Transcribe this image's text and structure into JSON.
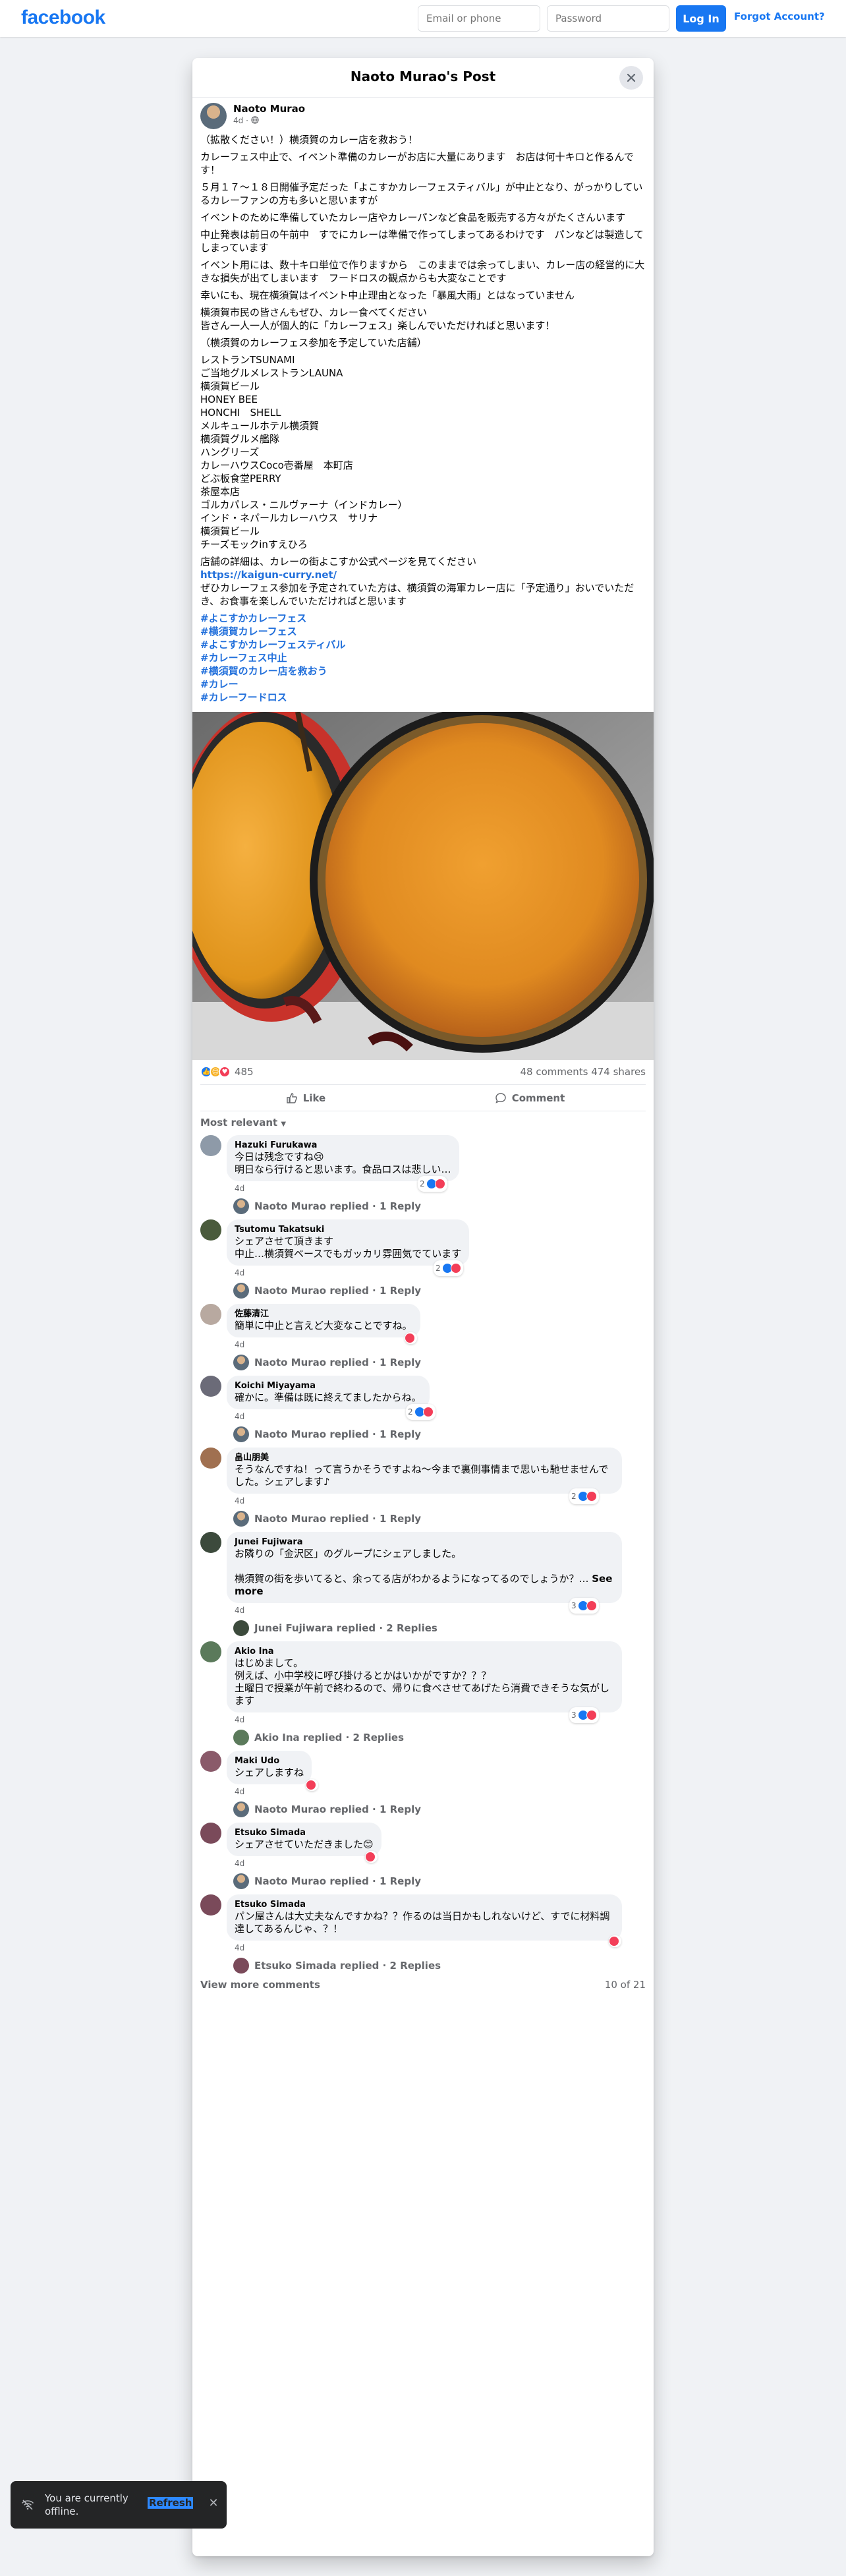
{
  "header": {
    "logo": "facebook",
    "email_placeholder": "Email or phone",
    "password_placeholder": "Password",
    "login_label": "Log In",
    "forgot_label": "Forgot Account?"
  },
  "dialog": {
    "title": "Naoto Murao's Post",
    "close_icon": "close-icon"
  },
  "post": {
    "author": "Naoto Murao",
    "time": "4d",
    "privacy_icon": "globe-icon",
    "paragraphs": [
      "（拡散ください！）横須賀のカレー店を救おう！",
      "カレーフェス中止で、イベント準備のカレーがお店に大量にあります　お店は何十キロと作るんです！",
      "５月１７〜１８日開催予定だった「よこすかカレーフェスティバル」が中止となり、がっかりしているカレーファンの方も多いと思いますが",
      "イベントのために準備していたカレー店やカレーパンなど食品を販売する方々がたくさんいます",
      "中止発表は前日の午前中　すでにカレーは準備で作ってしまってあるわけです　パンなどは製造してしまっています",
      "イベント用には、数十キロ単位で作りますから　このままでは余ってしまい、カレー店の経営的に大きな損失が出てしまいます　フードロスの観点からも大変なことです",
      "幸いにも、現在横須賀はイベント中止理由となった「暴風大雨」とはなっていません",
      "横須賀市民の皆さんもぜひ、カレー食べてください\n皆さん一人一人が個人的に「カレーフェス」楽しんでいただければと思います！",
      "（横須賀のカレーフェス参加を予定していた店舗）"
    ],
    "shops": [
      "レストランTSUNAMI",
      "ご当地グルメレストランLAUNA",
      "横須賀ビール",
      "HONEY BEE",
      "HONCHI　SHELL",
      "メルキュールホテル横須賀",
      "横須賀グルメ艦隊",
      "ハングリーズ",
      "カレーハウスCoco壱番屋　本町店",
      "どぶ板食堂PERRY",
      "茶屋本店",
      "ゴルカパレス・ニルヴァーナ（インドカレー）",
      "インド・ネパールカレーハウス　サリナ",
      "横須賀ビール",
      "チーズモックinすえひろ"
    ],
    "details_text": "店舗の詳細は、カレーの街よこすか公式ページを見てください",
    "details_link": "https://kaigun-curry.net/",
    "closing_text": "ぜひカレーフェス参加を予定されていた方は、横須賀の海軍カレー店に「予定通り」おいでいただき、お食事を楽しんでいただければと思います",
    "hashtags": [
      "#よこすかカレーフェス",
      "#横須賀カレーフェス",
      "#よこすかカレーフェスティバル",
      "#カレーフェス中止",
      "#横須賀のカレー店を救おう",
      "#カレー",
      "#カレーフードロス"
    ],
    "photo_icon": "curry-pots-photo",
    "reaction_count": "485",
    "comments_count": "48 comments",
    "shares_count": "474 shares",
    "like_label": "Like",
    "comment_label": "Comment",
    "sort_label": "Most relevant"
  },
  "comments": [
    {
      "name": "Hazuki Furukawa",
      "text": "今日は残念ですね😢\n明日なら行けると思います。食品ロスは悲しい…",
      "time": "4d",
      "reactions": "2",
      "reply_name": "Naoto Murao",
      "reply_text": "Naoto Murao replied · 1 Reply",
      "avatar_color": "#8e9aa8"
    },
    {
      "name": "Tsutomu Takatsuki",
      "text": "シェアさせて頂きます\n中止…横須賀ベースでもガッカリ雰囲気でています",
      "time": "4d",
      "reactions": "2",
      "reply_name": "Naoto Murao",
      "reply_text": "Naoto Murao replied · 1 Reply",
      "avatar_color": "#4a5b3c"
    },
    {
      "name": "佐藤清江",
      "text": "簡単に中止と言えど大変なことですね。",
      "time": "4d",
      "reactions": "",
      "reply_name": "Naoto Murao",
      "reply_text": "Naoto Murao replied · 1 Reply",
      "avatar_color": "#b8a9a0"
    },
    {
      "name": "Koichi Miyayama",
      "text": "確かに。準備は既に終えてましたからね。",
      "time": "4d",
      "reactions": "2",
      "reply_name": "Naoto Murao",
      "reply_text": "Naoto Murao replied · 1 Reply",
      "avatar_color": "#6b6b78"
    },
    {
      "name": "畠山朋美",
      "text": "そうなんですね！って言うかそうですよね〜今まで裏側事情まで思いも馳せませんでした。シェアします♪",
      "time": "4d",
      "reactions": "2",
      "reply_name": "Naoto Murao",
      "reply_text": "Naoto Murao replied · 1 Reply",
      "avatar_color": "#a07050"
    },
    {
      "name": "Junei Fujiwara",
      "text": "お隣りの「金沢区」のグループにシェアしました。\n\n横須賀の街を歩いてると、余ってる店がわかるようになってるのでしょうか？…",
      "see_more": "See more",
      "time": "4d",
      "reactions": "3",
      "reply_name": "Junei Fujiwara",
      "reply_text": "Junei Fujiwara replied · 2 Replies",
      "avatar_color": "#3c4a3c"
    },
    {
      "name": "Akio Ina",
      "text": "はじめまして。\n例えば、小中学校に呼び掛けるとかはいかがですか？？？\n土曜日で授業が午前で終わるので、帰りに食べさせてあげたら消費できそうな気がします",
      "time": "4d",
      "reactions": "3",
      "reply_name": "Akio Ina",
      "reply_text": "Akio Ina replied · 2 Replies",
      "avatar_color": "#5b7a5b"
    },
    {
      "name": "Maki Udo",
      "text": "シェアしますね",
      "time": "4d",
      "reactions": "",
      "reply_name": "Naoto Murao",
      "reply_text": "Naoto Murao replied · 1 Reply",
      "avatar_color": "#8a5a6a"
    },
    {
      "name": "Etsuko Simada",
      "text": "シェアさせていただきました😊",
      "time": "4d",
      "reactions": "",
      "reply_name": "Naoto Murao",
      "reply_text": "Naoto Murao replied · 1 Reply",
      "avatar_color": "#7a4a5a"
    },
    {
      "name": "Etsuko Simada",
      "text": "パン屋さんは大丈夫なんですかね？？作るのは当日かもしれないけど、すでに材料調達してあるんじゃ、？！",
      "time": "4d",
      "reactions": "",
      "reply_name": "Etsuko Simada",
      "reply_text": "Etsuko Simada replied · 2 Replies",
      "avatar_color": "#7a4a5a"
    }
  ],
  "view_more": {
    "label": "View more comments",
    "count": "10 of 21"
  },
  "toast": {
    "text": "You are currently offline.",
    "refresh_label": "Refresh",
    "icon": "wifi-off-icon",
    "close_icon": "close-icon"
  },
  "colors": {
    "brand": "#1877f2",
    "link": "#216fdb",
    "like_blue": "#1877f2",
    "love_red": "#f33e58",
    "haha_yellow": "#f7b125"
  }
}
